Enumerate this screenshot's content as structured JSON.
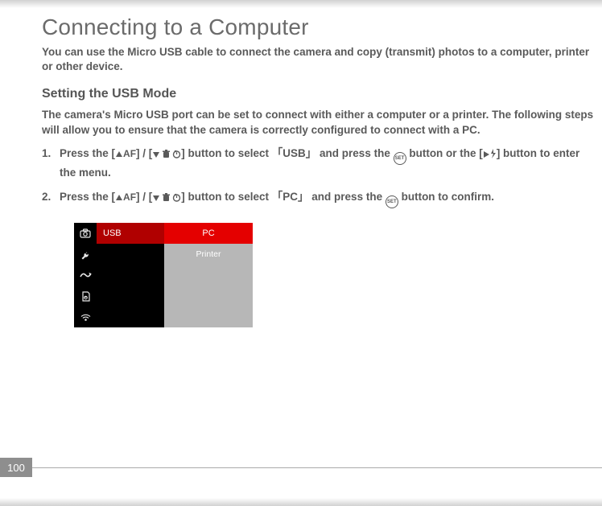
{
  "page": {
    "number": "100",
    "title": "Connecting to a Computer",
    "intro": "You can use the Micro USB cable to connect the camera and copy (transmit) photos to a computer, printer or other device.",
    "section_title": "Setting the USB Mode",
    "section_intro": "The camera's Micro USB port can be set to connect with either a computer or a printer. The following steps will allow you to ensure that the camera is correctly configured to connect with a PC."
  },
  "steps": {
    "s1": {
      "pre1": "Press the [",
      "up_af": "AF",
      "mid1": "] / [",
      "mid2": "] button to select 「",
      "target": "USB",
      "mid3": "」 and press the ",
      "set": "SET",
      "mid4": " button or the [",
      "tail": "] button to enter the menu."
    },
    "s2": {
      "pre1": "Press the [",
      "up_af": "AF",
      "mid1": "] / [",
      "mid2": "] button to select 「",
      "target": "PC",
      "mid3": "」 and press the ",
      "set": "SET",
      "tail": " button to confirm."
    }
  },
  "menu": {
    "row1": {
      "label": "USB",
      "value": "PC"
    },
    "row2": {
      "label": "",
      "value": "Printer"
    }
  }
}
